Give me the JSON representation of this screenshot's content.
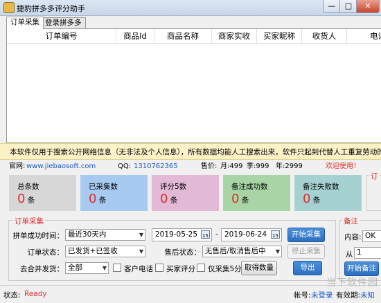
{
  "window": {
    "title": "捷豹拼多多评分助手",
    "min_icon": "—",
    "max_icon": "□",
    "close_icon": "✕"
  },
  "tabs": [
    "订单采集",
    "登录拼多多"
  ],
  "table": {
    "columns": [
      "订单编号",
      "商品Id",
      "商品名称",
      "商家实收",
      "买家昵称",
      "收货人",
      "电话"
    ]
  },
  "notice": "本软件仅用于搜索公开网络信息（无非法及个人信息），所有数据均能人工搜索出来，软件只起到代替人工重复劳动的功能。禁",
  "info": {
    "website_label": "官网:",
    "website": "www.jiebaosoft.com",
    "qq_label": "QQ:",
    "qq": "1310762365",
    "price_label": "售价:",
    "price_month": "月:499",
    "price_season": "季:999",
    "price_year": "年:2999",
    "welcome": "欢迎使用！"
  },
  "stats": [
    {
      "label": "总条数",
      "value": "0",
      "unit": "条",
      "bg": "#d7d7d7"
    },
    {
      "label": "已采集数",
      "value": "0",
      "unit": "条",
      "bg": "#a7cbf0"
    },
    {
      "label": "评分5数",
      "value": "0",
      "unit": "条",
      "bg": "#e2bad6"
    },
    {
      "label": "备注成功数",
      "value": "0",
      "unit": "条",
      "bg": "#a9d4a5"
    },
    {
      "label": "备注失败数",
      "value": "0",
      "unit": "条",
      "bg": "#a5d2d1"
    }
  ],
  "right_panel_title_fragment": "订",
  "collect": {
    "group_title": "订单采集",
    "time_label": "拼单成功时间：",
    "time_value": "最近30天内",
    "date_from": "2019-05-25",
    "date_sep": "-",
    "date_to": "2019-06-24",
    "cal_icon": "15",
    "start_button": "开始采集",
    "order_status_label": "订单状态：",
    "order_status_value": "已发货+已签收",
    "after_sale_label": "售后状态：",
    "after_sale_value": "无售后/取消售后中",
    "stop_button": "停止采集",
    "merge_label": "去合并发货：",
    "merge_value": "全部",
    "check_phone": "客户电话",
    "check_rating": "买家评分",
    "check_only5": "仅采集5分",
    "get_count_button": "取得数量",
    "export_button": "导出"
  },
  "remark": {
    "group_title": "备注",
    "content_label": "内容:",
    "content_value": "OK",
    "from_label": "从",
    "from_value": "1",
    "start_button": "开始备注"
  },
  "status": {
    "label": "状态:",
    "value": "Ready",
    "account_label": "帐号:",
    "account_value": "未登录",
    "expire_label": "有效期:",
    "expire_value": "未知"
  },
  "watermark": "当下软件园"
}
